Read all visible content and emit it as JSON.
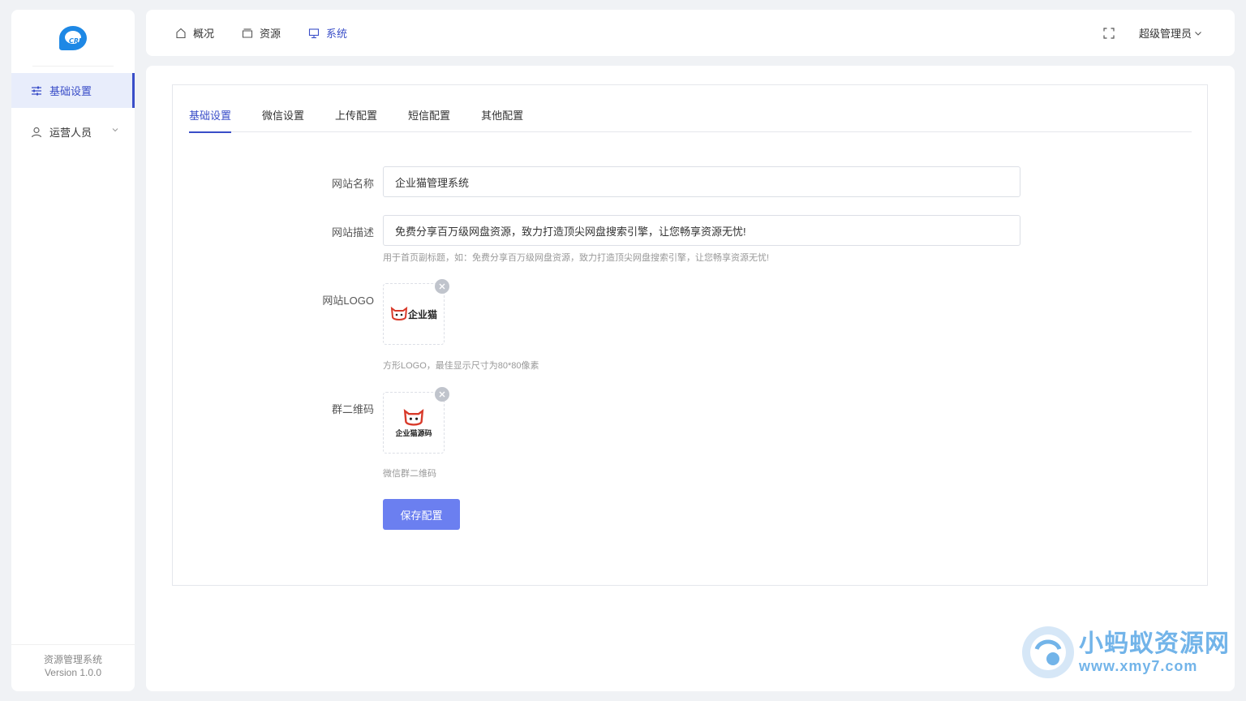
{
  "app": {
    "logo_text": "CRM"
  },
  "sidebar": {
    "items": [
      {
        "label": "基础设置",
        "icon": "sliders-icon",
        "active": true
      },
      {
        "label": "运营人员",
        "icon": "user-icon",
        "expandable": true
      }
    ],
    "footer": {
      "name": "资源管理系统",
      "version": "Version 1.0.0"
    }
  },
  "header": {
    "nav": [
      {
        "label": "概况",
        "icon": "home-icon"
      },
      {
        "label": "资源",
        "icon": "folder-icon"
      },
      {
        "label": "系统",
        "icon": "monitor-icon",
        "active": true
      }
    ],
    "user": "超级管理员"
  },
  "tabs": [
    {
      "label": "基础设置",
      "active": true
    },
    {
      "label": "微信设置"
    },
    {
      "label": "上传配置"
    },
    {
      "label": "短信配置"
    },
    {
      "label": "其他配置"
    }
  ],
  "form": {
    "site_name": {
      "label": "网站名称",
      "value": "企业猫管理系统"
    },
    "site_desc": {
      "label": "网站描述",
      "value": "免费分享百万级网盘资源，致力打造顶尖网盘搜索引擎，让您畅享资源无忧!",
      "hint": "用于首页副标题，如：免费分享百万级网盘资源，致力打造顶尖网盘搜索引擎，让您畅享资源无忧!"
    },
    "site_logo": {
      "label": "网站LOGO",
      "image_text": "企业猫",
      "hint": "方形LOGO，最佳显示尺寸为80*80像素"
    },
    "group_qr": {
      "label": "群二维码",
      "image_text": "企业猫源码",
      "hint": "微信群二维码"
    },
    "save_label": "保存配置"
  },
  "watermark": {
    "title": "小蚂蚁资源网",
    "url": "www.xmy7.com"
  },
  "colors": {
    "accent": "#3a4ec8",
    "button": "#6b7ff0",
    "background": "#f0f2f5"
  }
}
